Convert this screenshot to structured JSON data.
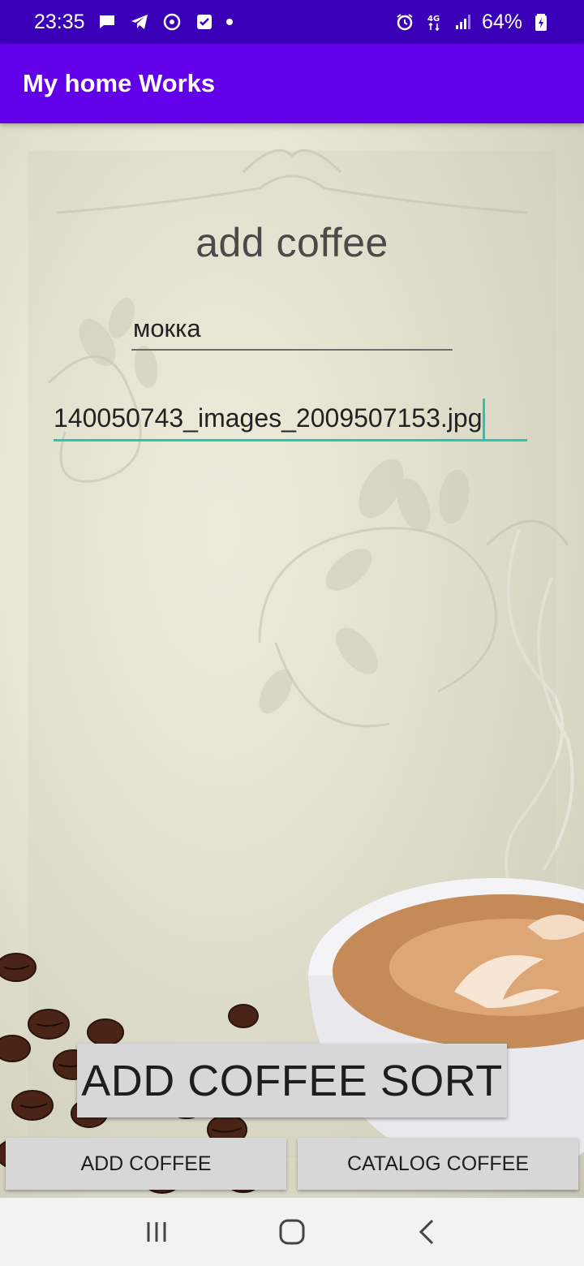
{
  "status_bar": {
    "time": "23:35",
    "battery": "64%",
    "left_icons": [
      "message-icon",
      "telegram-icon",
      "sync-icon",
      "check-box-icon",
      "dot-icon"
    ],
    "right_icons": [
      "alarm-icon",
      "4g-data-icon",
      "signal-icon",
      "battery-icon"
    ]
  },
  "app_bar": {
    "title": "My home Works"
  },
  "form": {
    "heading": "add coffee",
    "name_value": "мокка",
    "image_value": "140050743_images_2009507153.jpg",
    "submit_label": "ADD COFFEE SORT"
  },
  "bottom_buttons": {
    "add_label": "ADD COFFEE",
    "catalog_label": "CATALOG COFFEE"
  },
  "nav_bar": {
    "icons": [
      "recents-icon",
      "home-icon",
      "back-icon"
    ]
  },
  "colors": {
    "status_bar": "#3a00b8",
    "app_bar": "#6200ea",
    "accent": "#26c6b5",
    "button": "#d6d7d6"
  }
}
